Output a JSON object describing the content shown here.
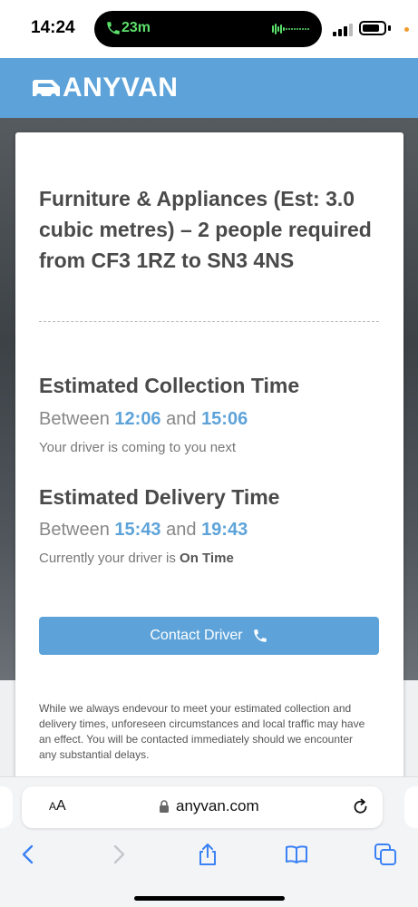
{
  "status_bar": {
    "time": "14:24",
    "call_duration": "23m"
  },
  "header": {
    "logo_text": "ANYVAN",
    "brand_color": "#5da3d9"
  },
  "job": {
    "title": "Furniture & Appliances (Est: 3.0 cubic metres) – 2 people required from CF3 1RZ to SN3 4NS"
  },
  "collection": {
    "heading": "Estimated Collection Time",
    "between": "Between",
    "start": "12:06",
    "and": "and",
    "end": "15:06",
    "note": "Your driver is coming to you next"
  },
  "delivery": {
    "heading": "Estimated Delivery Time",
    "between": "Between",
    "start": "15:43",
    "and": "and",
    "end": "19:43",
    "note_prefix": "Currently your driver is",
    "status": "On Time"
  },
  "contact_button": {
    "label": "Contact Driver",
    "icon": "phone-icon"
  },
  "disclaimer": "While we always endevour to meet your estimated collection and delivery times, unforeseen circumstances and local traffic may have an effect. You will be contacted immediately should we encounter any substantial delays.",
  "browser": {
    "aa_small": "A",
    "aa_large": "A",
    "url": "anyvan.com",
    "toolbar_icons": [
      "back-icon",
      "forward-icon",
      "share-icon",
      "bookmarks-icon",
      "tabs-icon"
    ]
  }
}
